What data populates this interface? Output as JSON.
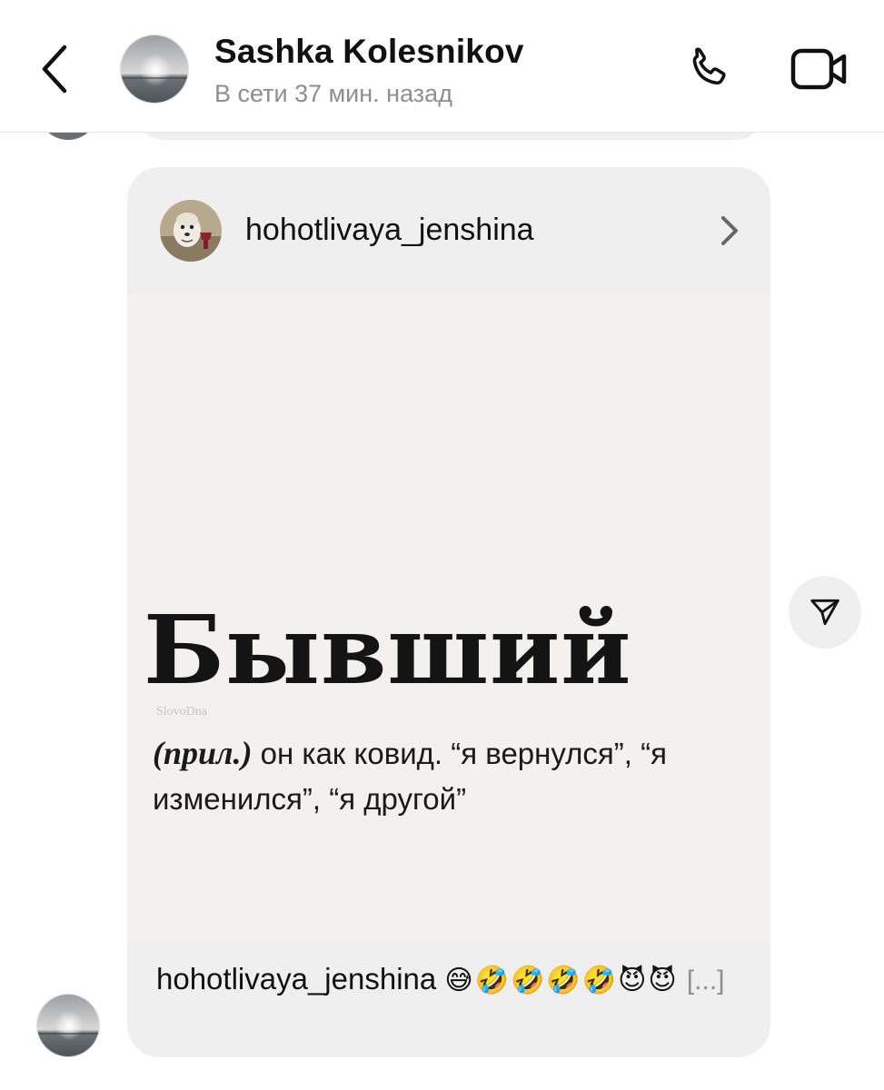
{
  "header": {
    "contact_name": "Sashka Kolesnikov",
    "status": "В сети 37 мин. назад",
    "back_icon": "chevron-left-icon",
    "call_icon": "phone-icon",
    "video_icon": "video-camera-icon"
  },
  "post": {
    "author": "hohotlivaya_jenshina",
    "chevron_icon": "chevron-right-icon",
    "image": {
      "word": "Бывший",
      "watermark": "SlovoDna",
      "part_of_speech": "(прил.)",
      "definition": " он как ковид. “я вернулся”, “я изменился”, “я другой”"
    },
    "caption": {
      "author": "hohotlivaya_jenshina",
      "emojis": "😅🤣🤣🤣🤣😈😈",
      "more": "[...]"
    }
  },
  "share_icon": "paper-plane-icon",
  "colors": {
    "bubble": "#efefef",
    "post_image_bg": "#f3f1ed",
    "secondary_text": "#8e8e8e"
  }
}
